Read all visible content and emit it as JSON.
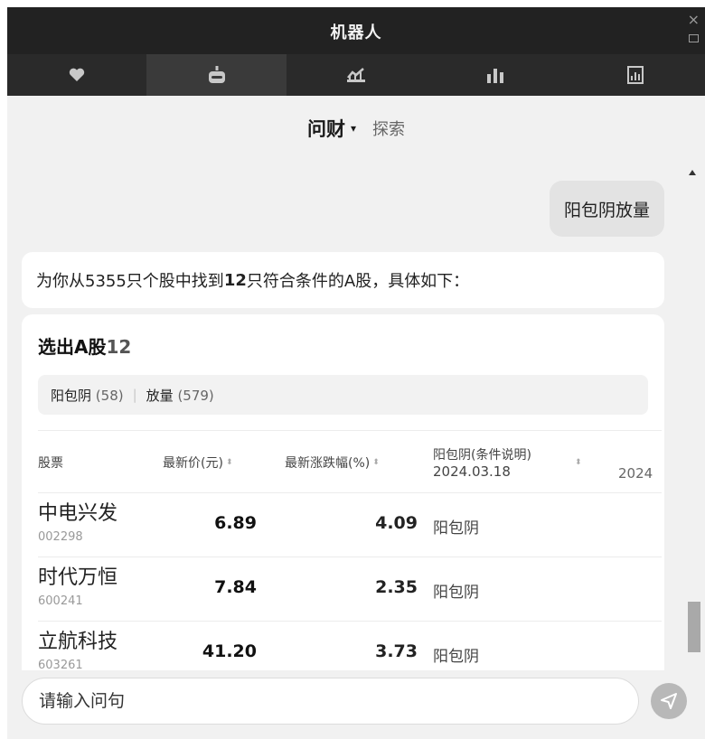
{
  "window": {
    "title": "机器人",
    "close_glyph": "×"
  },
  "tabs": [
    {
      "icon": "heart-icon",
      "active": false
    },
    {
      "icon": "robot-icon",
      "active": true
    },
    {
      "icon": "trend-chart-icon",
      "active": false
    },
    {
      "icon": "bar-chart-icon",
      "active": false
    },
    {
      "icon": "report-icon",
      "active": false
    }
  ],
  "modes": {
    "main": "问财",
    "caret": "▾",
    "alt": "探索"
  },
  "chat": {
    "user_query": "阳包阴放量",
    "bot_reply": {
      "prefix": "为你从5355只个股中找到",
      "count": "12",
      "suffix": "只符合条件的A股，具体如下："
    }
  },
  "result_card": {
    "title": "选出A股",
    "count": "12",
    "filters": [
      {
        "label": "阳包阴",
        "count": "(58)"
      },
      {
        "label": "放量",
        "count": "(579)"
      }
    ],
    "filter_separator": "|",
    "columns": {
      "stock": "股票",
      "price": "最新价(元)",
      "change": "最新涨跌幅(%)",
      "condition": "阳包阴(条件说明)",
      "condition_date": "2024.03.18",
      "extra_partial": "2024"
    },
    "sort_glyph": "⬍",
    "rows": [
      {
        "name": "中电兴发",
        "code": "002298",
        "price": "6.89",
        "change": "4.09",
        "condition": "阳包阴"
      },
      {
        "name": "时代万恒",
        "code": "600241",
        "price": "7.84",
        "change": "2.35",
        "condition": "阳包阴"
      },
      {
        "name": "立航科技",
        "code": "603261",
        "price": "41.20",
        "change": "3.73",
        "condition": "阳包阴"
      }
    ]
  },
  "input": {
    "placeholder": "请输入问句"
  },
  "colors": {
    "titlebar_bg": "#222222",
    "tabbar_bg": "#2a2a2a",
    "tab_active_bg": "#3a3a3a",
    "icon_color": "#c8c8c8",
    "panel_bg": "#f1f1f1",
    "send_button": "#b8b8b8"
  }
}
